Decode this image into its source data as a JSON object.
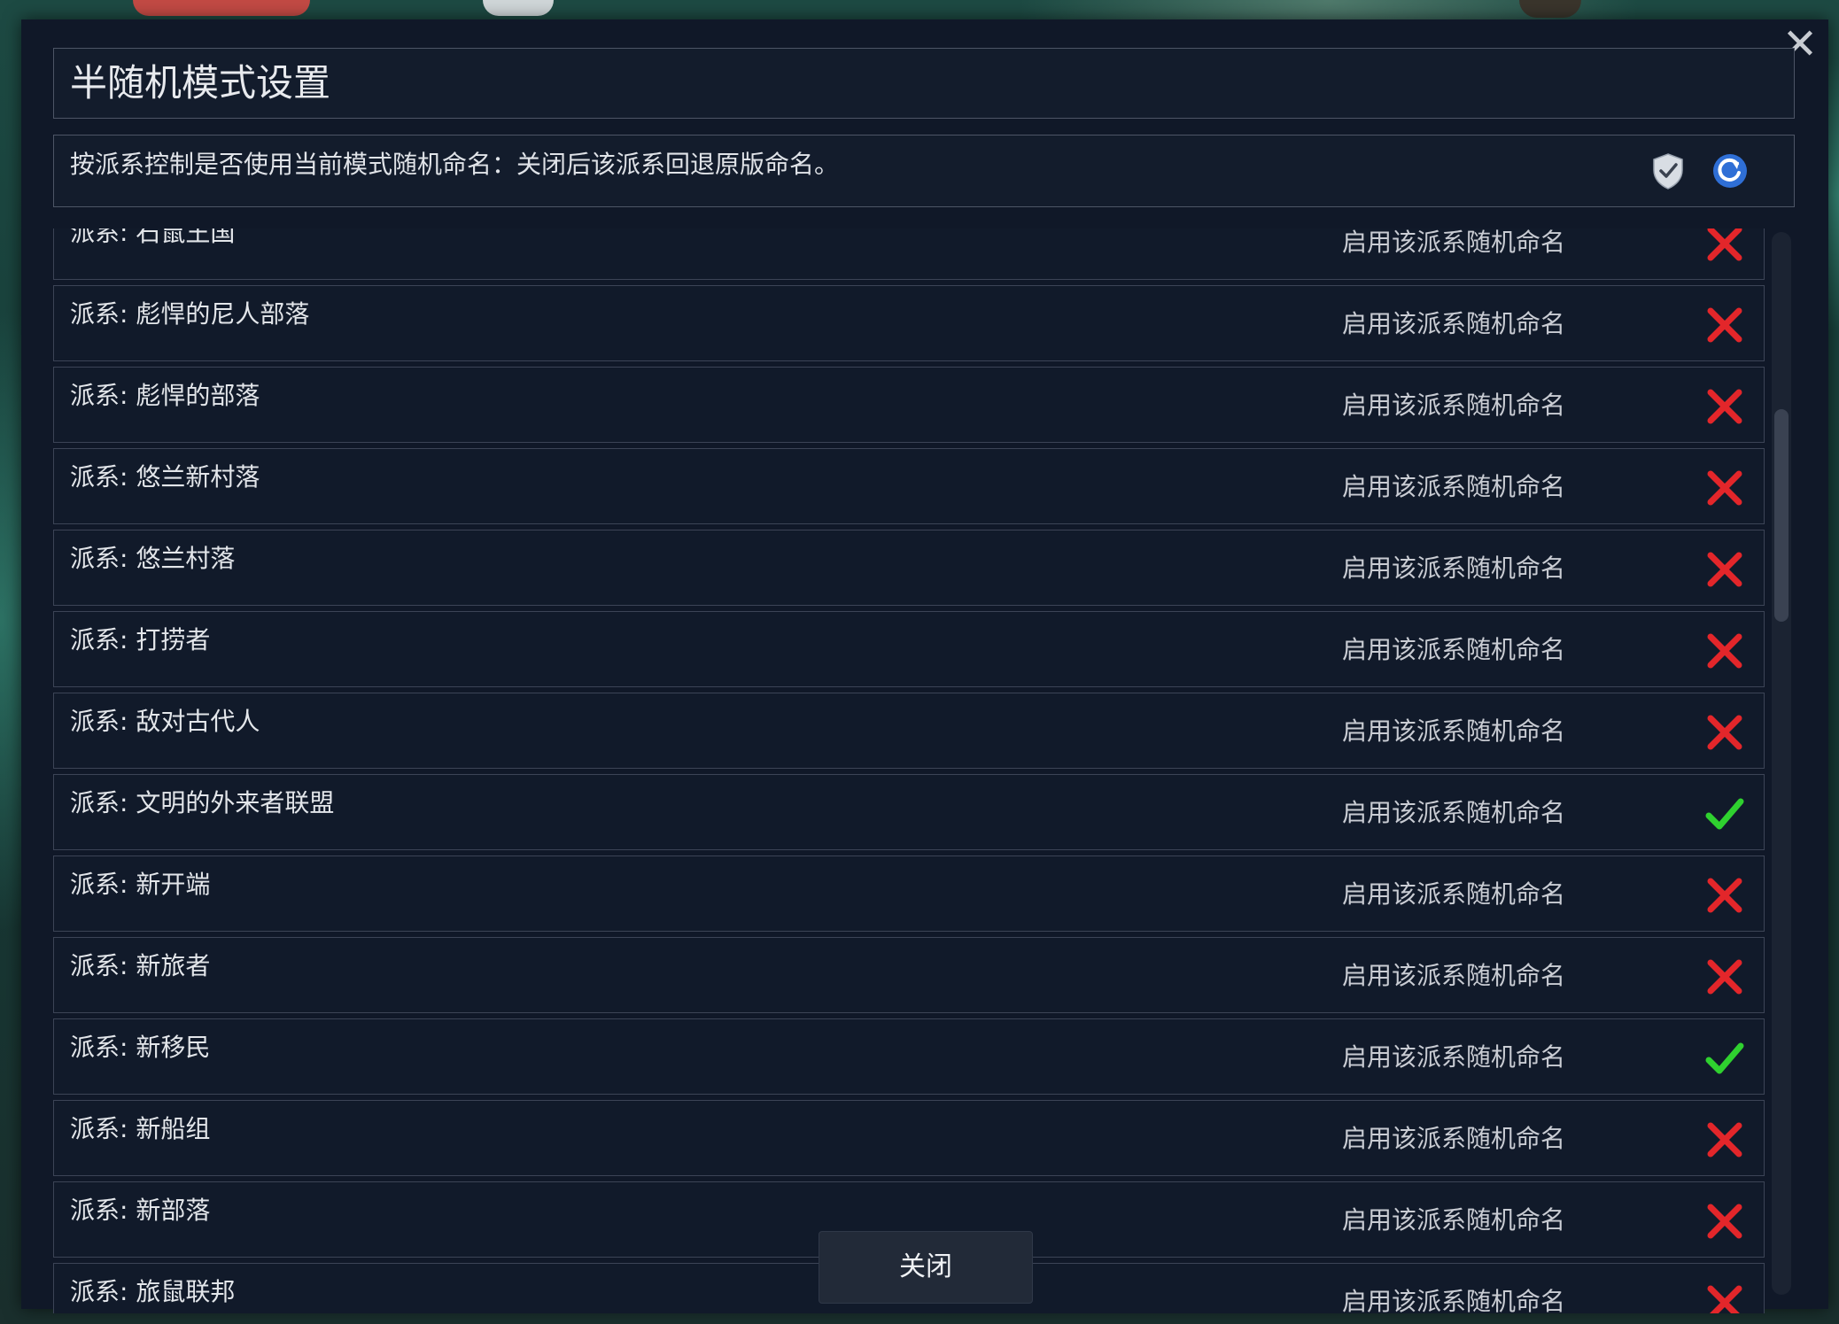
{
  "dialog": {
    "title": "半随机模式设置",
    "description": "按派系控制是否使用当前模式随机命名：关闭后该派系回退原版命名。",
    "close_button_label": "关闭",
    "icons": [
      "shield-check-icon",
      "refresh-icon"
    ]
  },
  "factions": [
    {
      "label": "派系: 石鼠王国",
      "toggle_text": "启用该派系随机命名",
      "enabled": false
    },
    {
      "label": "派系: 彪悍的尼人部落",
      "toggle_text": "启用该派系随机命名",
      "enabled": false
    },
    {
      "label": "派系: 彪悍的部落",
      "toggle_text": "启用该派系随机命名",
      "enabled": false
    },
    {
      "label": "派系: 悠兰新村落",
      "toggle_text": "启用该派系随机命名",
      "enabled": false
    },
    {
      "label": "派系: 悠兰村落",
      "toggle_text": "启用该派系随机命名",
      "enabled": false
    },
    {
      "label": "派系: 打捞者",
      "toggle_text": "启用该派系随机命名",
      "enabled": false
    },
    {
      "label": "派系: 敌对古代人",
      "toggle_text": "启用该派系随机命名",
      "enabled": false
    },
    {
      "label": "派系: 文明的外来者联盟",
      "toggle_text": "启用该派系随机命名",
      "enabled": true
    },
    {
      "label": "派系: 新开端",
      "toggle_text": "启用该派系随机命名",
      "enabled": false
    },
    {
      "label": "派系: 新旅者",
      "toggle_text": "启用该派系随机命名",
      "enabled": false
    },
    {
      "label": "派系: 新移民",
      "toggle_text": "启用该派系随机命名",
      "enabled": true
    },
    {
      "label": "派系: 新船组",
      "toggle_text": "启用该派系随机命名",
      "enabled": false
    },
    {
      "label": "派系: 新部落",
      "toggle_text": "启用该派系随机命名",
      "enabled": false
    },
    {
      "label": "派系: 旅鼠联邦",
      "toggle_text": "启用该派系随机命名",
      "enabled": false
    }
  ],
  "colors": {
    "enabled": "#2fd12f",
    "disabled": "#e3262a"
  }
}
